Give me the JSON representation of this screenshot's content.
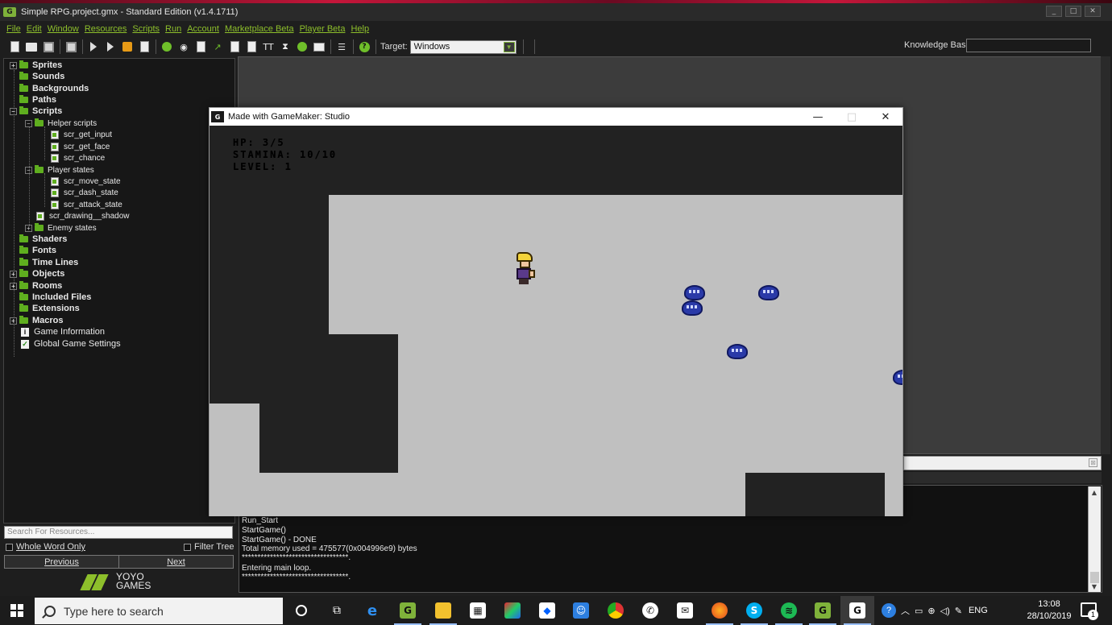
{
  "window": {
    "title": "Simple RPG.project.gmx  -  Standard Edition (v1.4.1711)"
  },
  "menu": [
    "File",
    "Edit",
    "Window",
    "Resources",
    "Scripts",
    "Run",
    "Account",
    "Marketplace Beta",
    "Player Beta",
    "Help"
  ],
  "toolbar": {
    "target_label": "Target:",
    "target_value": "Windows",
    "knowledge_base_label": "Knowledge Base:",
    "knowledge_base_value": ""
  },
  "tree": {
    "sprites": "Sprites",
    "sounds": "Sounds",
    "backgrounds": "Backgrounds",
    "paths": "Paths",
    "scripts": "Scripts",
    "helper_scripts": "Helper scripts",
    "scr_get_input": "scr_get_input",
    "scr_get_face": "scr_get_face",
    "scr_chance": "scr_chance",
    "player_states": "Player states",
    "scr_move_state": "scr_move_state",
    "scr_dash_state": "scr_dash_state",
    "scr_attack_state": "scr_attack_state",
    "scr_drawing_shadow": "scr_drawing__shadow",
    "enemy_states": "Enemy states",
    "shaders": "Shaders",
    "fonts": "Fonts",
    "time_lines": "Time Lines",
    "objects": "Objects",
    "rooms": "Rooms",
    "included_files": "Included Files",
    "extensions": "Extensions",
    "macros": "Macros",
    "game_information": "Game Information",
    "global_game_settings": "Global Game Settings"
  },
  "search": {
    "placeholder": "Search For Resources...",
    "whole_word_only": "Whole Word Only",
    "filter_tree": "Filter Tree",
    "previous": "Previous",
    "next": "Next"
  },
  "brand": {
    "line1": "YOYO",
    "line2": "GAMES"
  },
  "output": [
    "Run_Start",
    "StartGame()",
    "StartGame() - DONE",
    "Total memory used = 475577(0x004996e9) bytes",
    "**********************************.",
    "Entering main loop.",
    "**********************************."
  ],
  "game": {
    "title": "Made with GameMaker: Studio",
    "hud": {
      "hp": "HP: 3/5",
      "stamina": "STAMINA: 10/10",
      "level": "LEVEL: 1"
    },
    "floor_color": "#c0c0c0",
    "slime_color": "#2a3aa8"
  },
  "taskbar": {
    "search_placeholder": "Type here to search",
    "language": "ENG",
    "time": "13:08",
    "date": "28/10/2019",
    "notification_count": "1"
  },
  "colors": {
    "accent_green": "#8dbf2b",
    "folder_green": "#5fae1f"
  }
}
